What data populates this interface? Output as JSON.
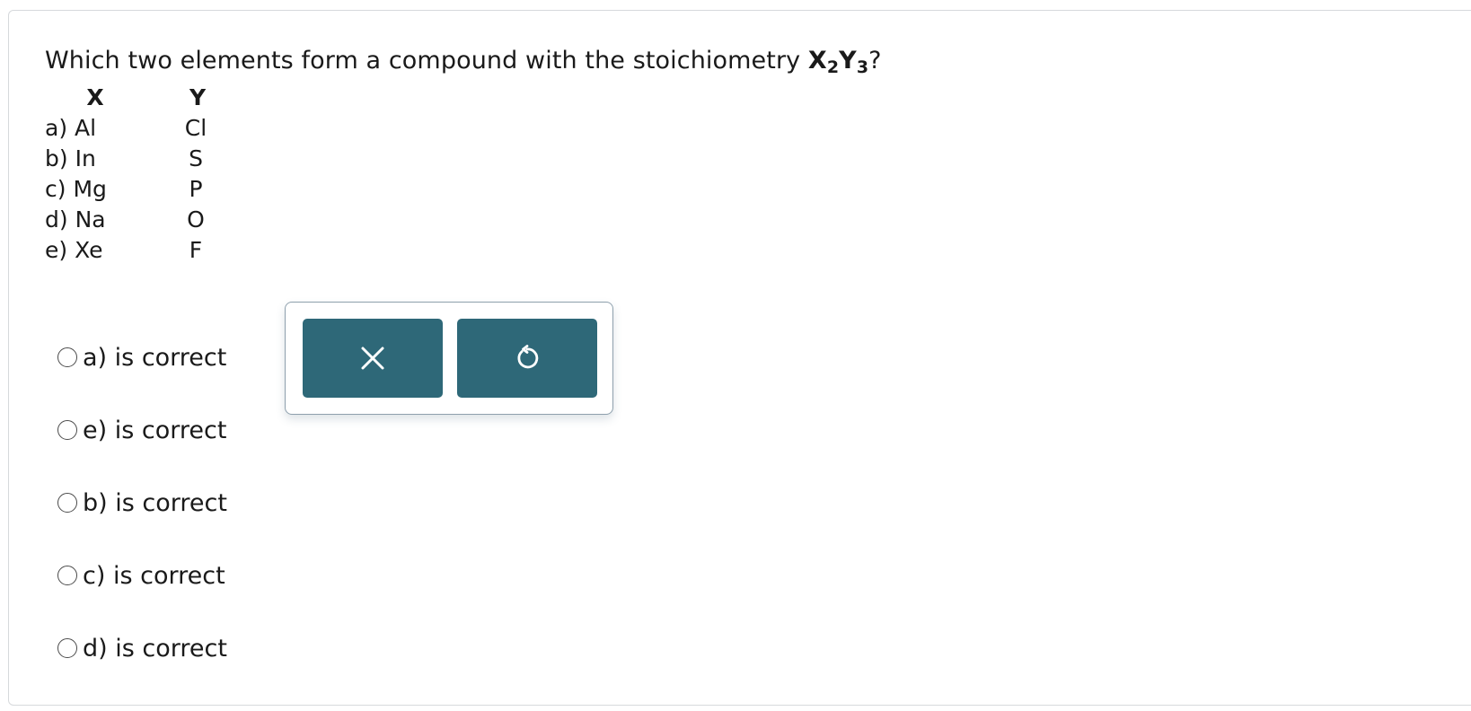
{
  "question": {
    "text": "Which two elements form a compound with the stoichiometry ",
    "formula": {
      "x": "X",
      "x_sub": "2",
      "y": "Y",
      "y_sub": "3"
    },
    "end": "?"
  },
  "table": {
    "headers": {
      "x": "X",
      "y": "Y"
    },
    "rows": [
      {
        "x": "a) Al",
        "y": "Cl"
      },
      {
        "x": "b) In",
        "y": "S"
      },
      {
        "x": "c) Mg",
        "y": "P"
      },
      {
        "x": "d) Na",
        "y": "O"
      },
      {
        "x": "e) Xe",
        "y": "F"
      }
    ]
  },
  "options": [
    {
      "label": "a) is correct"
    },
    {
      "label": "e) is correct"
    },
    {
      "label": "b) is correct"
    },
    {
      "label": "c) is correct"
    },
    {
      "label": "d) is correct"
    }
  ],
  "toolbar": {
    "clear_icon": "close-icon",
    "reset_icon": "undo-icon",
    "button_color": "#2e6878"
  }
}
